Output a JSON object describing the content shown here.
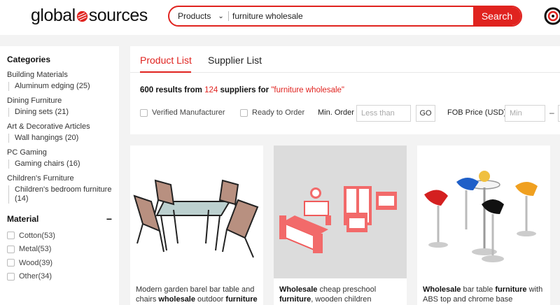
{
  "header": {
    "logo_left": "global",
    "logo_right": "sources",
    "search_category": "Products",
    "search_value": "furniture wholesale",
    "search_button": "Search"
  },
  "sidebar": {
    "categories_title": "Categories",
    "categories": [
      {
        "name": "Building Materials",
        "sub": "Aluminum edging (25)"
      },
      {
        "name": "Dining Furniture",
        "sub": "Dining sets (21)"
      },
      {
        "name": "Art & Decorative Articles",
        "sub": "Wall hangings (20)"
      },
      {
        "name": "PC Gaming",
        "sub": "Gaming chairs (16)"
      },
      {
        "name": "Children's Furniture",
        "sub": "Children's bedroom furniture (14)"
      }
    ],
    "material_title": "Material",
    "material_toggle": "−",
    "materials": [
      "Cotton(53)",
      "Metal(53)",
      "Wood(39)",
      "Other(34)"
    ]
  },
  "tabs": {
    "product_list": "Product List",
    "supplier_list": "Supplier List"
  },
  "results": {
    "count": "600",
    "results_from": "results from",
    "suppliers_count": "124",
    "suppliers_for": "suppliers for",
    "query": "\"furniture wholesale\""
  },
  "filters": {
    "verified_manufacturer": "Verified Manufacturer",
    "ready_to_order": "Ready to Order",
    "min_order_label": "Min. Order",
    "min_order_placeholder": "Less than",
    "go_button": "GO",
    "fob_label": "FOB Price (USD)",
    "fob_min_placeholder": "Min",
    "fob_dash": "–"
  },
  "products": [
    {
      "desc_plain_1": "Modern garden barel bar table and chairs ",
      "desc_bold_1": "wholesale",
      "desc_plain_2": " outdoor ",
      "desc_bold_2": "furniture"
    },
    {
      "desc_bold_1": "Wholesale",
      "desc_plain_1": " cheap preschool ",
      "desc_bold_2": "furniture",
      "desc_plain_2": ", wooden children bedroo..."
    },
    {
      "desc_bold_1": "Wholesale",
      "desc_plain_1": " bar table ",
      "desc_bold_2": "furniture",
      "desc_plain_2": " with ABS top and chrome base"
    }
  ],
  "colors": {
    "accent": "#e0231f",
    "background": "#f3f3f3",
    "card": "#ffffff"
  },
  "icons": [
    "logo-mark-icon",
    "chevron-down-icon",
    "notification-ring-icon"
  ]
}
